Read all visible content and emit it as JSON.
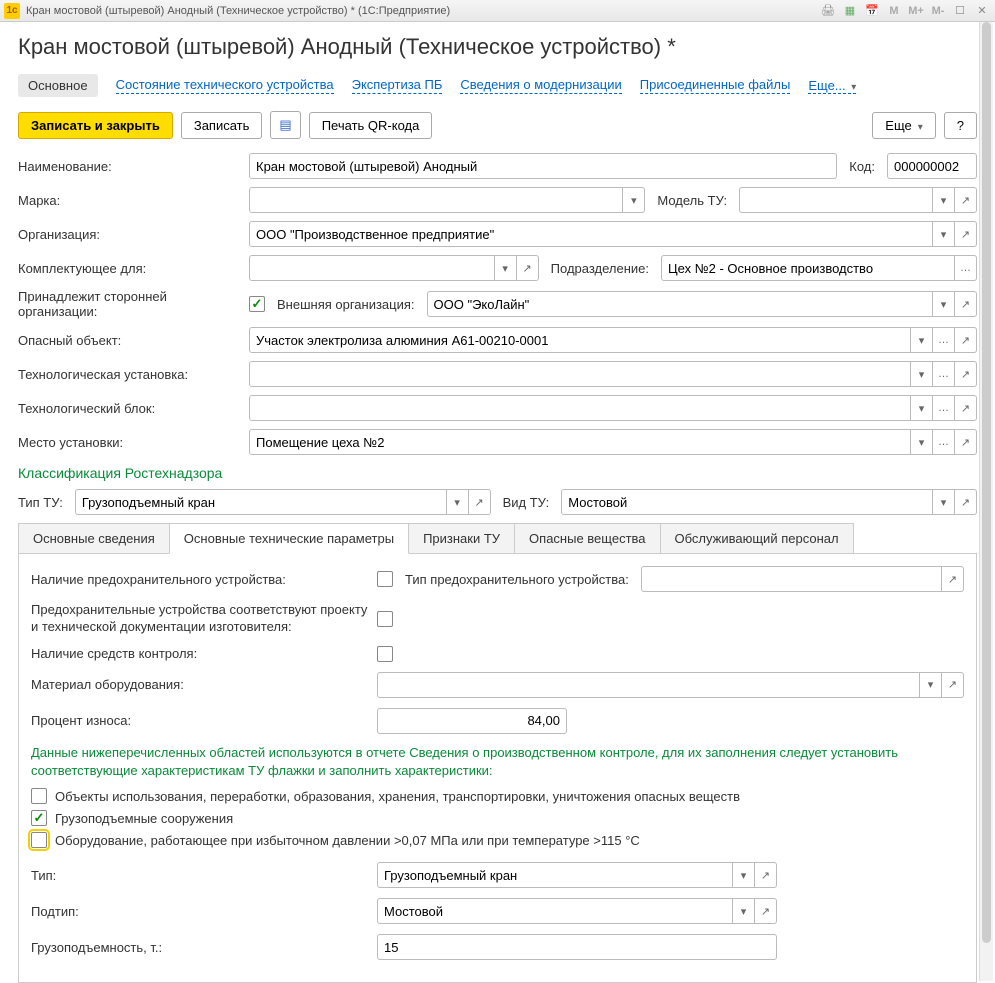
{
  "titlebar": {
    "text": "Кран мостовой (штыревой) Анодный (Техническое устройство) *   (1С:Предприятие)"
  },
  "page": {
    "title": "Кран мостовой (штыревой) Анодный (Техническое устройство) *"
  },
  "nav": {
    "tabs": [
      "Основное",
      "Состояние технического устройства",
      "Экспертиза ПБ",
      "Сведения о модернизации",
      "Присоединенные файлы"
    ],
    "more": "Еще..."
  },
  "toolbar": {
    "save_close": "Записать и закрыть",
    "save": "Записать",
    "print_qr": "Печать QR-кода",
    "more": "Еще",
    "help": "?"
  },
  "fields": {
    "name_label": "Наименование:",
    "name_value": "Кран мостовой (штыревой) Анодный",
    "code_label": "Код:",
    "code_value": "000000002",
    "brand_label": "Марка:",
    "brand_value": "",
    "model_label": "Модель ТУ:",
    "model_value": "",
    "org_label": "Организация:",
    "org_value": "ООО \"Производственное предприятие\"",
    "component_label": "Комплектующее для:",
    "component_value": "",
    "dept_label": "Подразделение:",
    "dept_value": "Цех №2 - Основное производство",
    "external_owner_label": "Принадлежит сторонней организации:",
    "external_org_label": "Внешняя организация:",
    "external_org_value": "ООО \"ЭкоЛайн\"",
    "hazard_label": "Опасный объект:",
    "hazard_value": "Участок электролиза алюминия А61-00210-0001",
    "tech_install_label": "Технологическая установка:",
    "tech_install_value": "",
    "tech_block_label": "Технологический блок:",
    "tech_block_value": "",
    "location_label": "Место установки:",
    "location_value": "Помещение цеха №2"
  },
  "classification": {
    "header": "Классификация Ростехнадзора",
    "type_label": "Тип ТУ:",
    "type_value": "Грузоподъемный кран",
    "kind_label": "Вид ТУ:",
    "kind_value": "Мостовой"
  },
  "subtabs": {
    "items": [
      "Основные сведения",
      "Основные технические параметры",
      "Признаки ТУ",
      "Опасные вещества",
      "Обслуживающий персонал"
    ]
  },
  "params": {
    "safety_device_label": "Наличие предохранительного устройства:",
    "safety_type_label": "Тип предохранительного устройства:",
    "safety_type_value": "",
    "safety_match_label": "Предохранительные устройства соответствуют проекту и технической документации изготовителя:",
    "control_label": "Наличие средств контроля:",
    "material_label": "Материал оборудования:",
    "material_value": "",
    "wear_label": "Процент износа:",
    "wear_value": "84,00",
    "note": "Данные нижеперечисленных областей используются в отчете Сведения о производственном контроле, для их заполнения следует установить соответствующие характеристикам ТУ флажки и заполнить характеристики:",
    "cb1": "Объекты использования, переработки, образования, хранения, транспортировки, уничтожения опасных веществ",
    "cb2": "Грузоподъемные сооружения",
    "cb3": "Оборудование, работающее при избыточном давлении >0,07 МПа или при температуре >115 °С",
    "tip_label": "Тип:",
    "tip_value": "Грузоподъемный кран",
    "subtype_label": "Подтип:",
    "subtype_value": "Мостовой",
    "capacity_label": "Грузоподъемность, т.:",
    "capacity_value": "15"
  }
}
